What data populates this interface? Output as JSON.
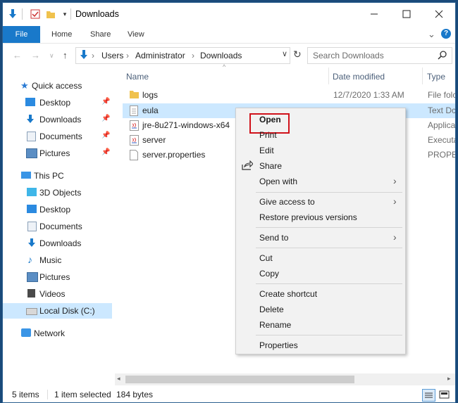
{
  "window": {
    "title": "Downloads",
    "controls": [
      "minimize-icon",
      "maximize-icon",
      "close-icon"
    ]
  },
  "quick_access_toolbar": [
    "down-arrow-icon",
    "properties-check-icon",
    "folder-icon",
    "chevron-down-icon"
  ],
  "ribbon": {
    "tabs": [
      "File",
      "Home",
      "Share",
      "View"
    ],
    "icons": [
      "chevron-down-icon",
      "help-icon"
    ]
  },
  "address_bar": {
    "nav_icons": [
      "back-arrow-icon",
      "forward-arrow-icon",
      "chevron-down-icon",
      "up-arrow-icon"
    ],
    "path": [
      "Users",
      "Administrator",
      "Downloads"
    ],
    "search_placeholder": "Search Downloads"
  },
  "sidebar": {
    "quick_access": {
      "label": "Quick access",
      "items": [
        {
          "label": "Desktop",
          "pinned": true,
          "icon": "desktop-icon"
        },
        {
          "label": "Downloads",
          "pinned": true,
          "icon": "downloads-icon"
        },
        {
          "label": "Documents",
          "pinned": true,
          "icon": "documents-icon"
        },
        {
          "label": "Pictures",
          "pinned": true,
          "icon": "pictures-icon"
        }
      ]
    },
    "this_pc": {
      "label": "This PC",
      "items": [
        {
          "label": "3D Objects",
          "icon": "3d-objects-icon"
        },
        {
          "label": "Desktop",
          "icon": "desktop-icon"
        },
        {
          "label": "Documents",
          "icon": "documents-icon"
        },
        {
          "label": "Downloads",
          "icon": "downloads-icon"
        },
        {
          "label": "Music",
          "icon": "music-icon"
        },
        {
          "label": "Pictures",
          "icon": "pictures-icon"
        },
        {
          "label": "Videos",
          "icon": "videos-icon"
        },
        {
          "label": "Local Disk (C:)",
          "icon": "disk-icon",
          "selected": true
        }
      ]
    },
    "network": {
      "label": "Network"
    }
  },
  "file_list": {
    "columns": [
      "Name",
      "Date modified",
      "Type"
    ],
    "files": [
      {
        "name": "logs",
        "date": "12/7/2020 1:33 AM",
        "type": "File folc",
        "icon": "folder-icon"
      },
      {
        "name": "eula",
        "date": "",
        "type": "Text Dc",
        "icon": "text-file-icon",
        "selected": true
      },
      {
        "name": "jre-8u271-windows-x64",
        "date": "",
        "type": "Applica",
        "icon": "java-icon"
      },
      {
        "name": "server",
        "date": "",
        "type": "Executa",
        "icon": "java-icon"
      },
      {
        "name": "server.properties",
        "date": "",
        "type": "PROPER",
        "icon": "file-icon"
      }
    ]
  },
  "context_menu": {
    "items": [
      {
        "label": "Open",
        "bold": true,
        "highlighted": true
      },
      {
        "label": "Print"
      },
      {
        "label": "Edit"
      },
      {
        "label": "Share",
        "icon": "share-icon"
      },
      {
        "label": "Open with",
        "submenu": true
      },
      {
        "label": "Give access to",
        "submenu": true
      },
      {
        "label": "Restore previous versions"
      },
      {
        "label": "Send to",
        "submenu": true
      },
      {
        "label": "Cut"
      },
      {
        "label": "Copy"
      },
      {
        "label": "Create shortcut"
      },
      {
        "label": "Delete"
      },
      {
        "label": "Rename"
      },
      {
        "label": "Properties"
      }
    ]
  },
  "status_bar": {
    "item_count": "5 items",
    "selection": "1 item selected",
    "size": "184 bytes",
    "view_icons": [
      "details-view-icon",
      "large-icons-view-icon"
    ]
  },
  "colors": {
    "file_tab": "#1979ca",
    "selection": "#cce8ff",
    "highlight_border": "#d0121b",
    "menu_bg": "#f2f2f2"
  }
}
